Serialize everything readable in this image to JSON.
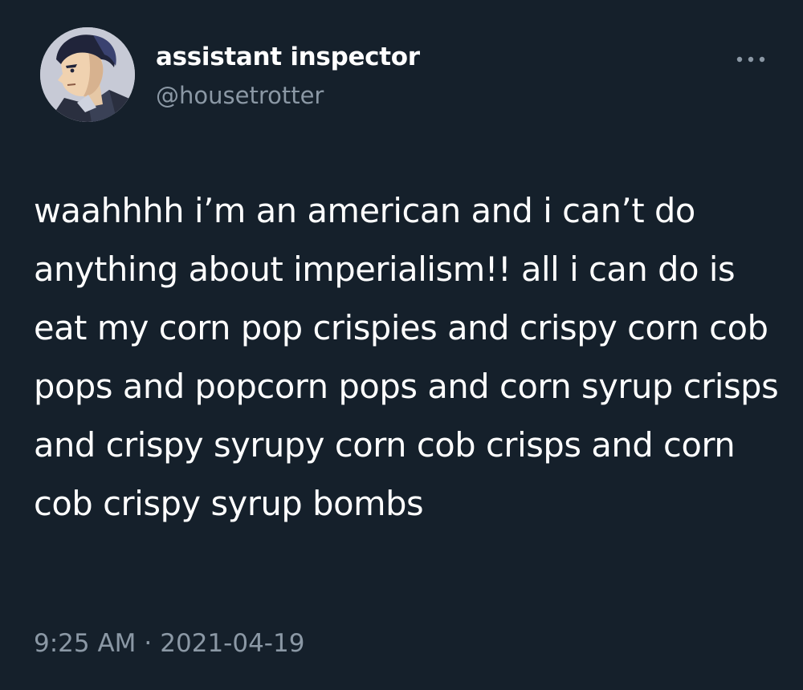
{
  "author": {
    "display_name": "assistant inspector",
    "handle": "@housetrotter",
    "avatar_icon": "avatar-illustration"
  },
  "menu": {
    "icon": "more-horizontal-icon"
  },
  "tweet": {
    "text": "waahhhh i’m an american and i can’t do anything about imperialism!! all i can do is eat my corn pop crispies and crispy corn cob pops and popcorn pops and corn syrup crisps and crispy syrupy corn cob crisps and corn cob crispy syrup bombs"
  },
  "meta": {
    "time": "9:25 AM",
    "separator": "·",
    "date": "2021-04-19"
  },
  "colors": {
    "background": "#15202b",
    "primary_text": "#ffffff",
    "secondary_text": "#8b98a5"
  }
}
